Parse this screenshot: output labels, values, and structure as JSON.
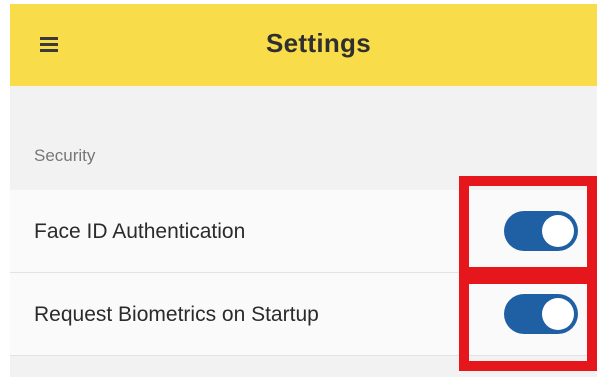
{
  "header": {
    "title": "Settings",
    "menu_icon": "hamburger-menu-icon",
    "background_color": "#f8dc4a"
  },
  "security": {
    "section_label": "Security",
    "items": [
      {
        "label": "Face ID Authentication",
        "enabled": true
      },
      {
        "label": "Request Biometrics on Startup",
        "enabled": true
      }
    ]
  },
  "colors": {
    "toggle_on": "#1f5fa3",
    "highlight": "#e5161c",
    "list_background": "#f2f2f2"
  }
}
